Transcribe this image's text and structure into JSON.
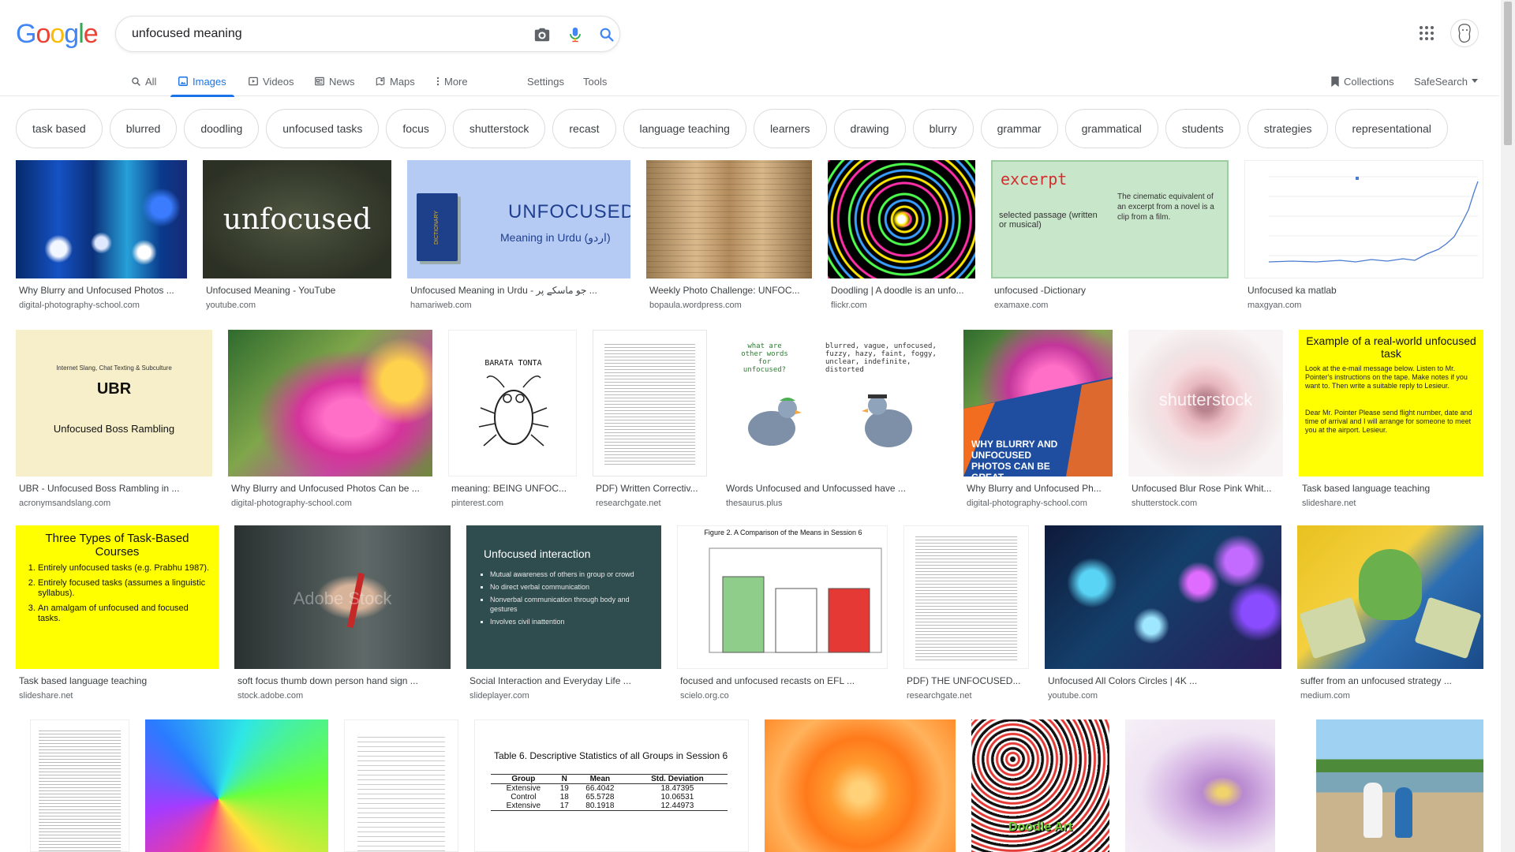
{
  "logo": [
    "G",
    "o",
    "o",
    "g",
    "l",
    "e"
  ],
  "search": {
    "query": "unfocused meaning"
  },
  "nav": {
    "tabs": [
      "All",
      "Images",
      "Videos",
      "News",
      "Maps",
      "More"
    ],
    "settings": "Settings",
    "tools": "Tools",
    "collections": "Collections",
    "safesearch": "SafeSearch"
  },
  "chips": [
    "task based",
    "blurred",
    "doodling",
    "unfocused tasks",
    "focus",
    "shutterstock",
    "recast",
    "language teaching",
    "learners",
    "drawing",
    "blurry",
    "grammar",
    "grammatical",
    "students",
    "strategies",
    "representational"
  ],
  "results": [
    {
      "title": "Why Blurry and Unfocused Photos ...",
      "source": "digital-photography-school.com"
    },
    {
      "title": "Unfocused Meaning - YouTube",
      "source": "youtube.com",
      "text": "unfocused"
    },
    {
      "title": "Unfocused Meaning in Urdu - جو ماسکے پر ...",
      "source": "hamariweb.com",
      "text": "UNFOCUSED",
      "text2": "Meaning in Urdu (اردو)",
      "text3": "DICTIONARY"
    },
    {
      "title": "Weekly Photo Challenge: UNFOC...",
      "source": "bopaula.wordpress.com"
    },
    {
      "title": "Doodling | A doodle is an unfo...",
      "source": "flickr.com"
    },
    {
      "title": "unfocused -Dictionary",
      "source": "examaxe.com",
      "text": "excerpt",
      "text2": "selected passage (written or musical)",
      "text3": "The cinematic equivalent of an excerpt from a novel is a clip from a film."
    },
    {
      "title": "Unfocused ka matlab",
      "source": "maxgyan.com"
    },
    {
      "title": "UBR - Unfocused Boss Rambling in ...",
      "source": "acronymsandslang.com",
      "text": "UBR",
      "text2": "Unfocused Boss Rambling",
      "text3": "Internet Slang, Chat Texting & Subculture"
    },
    {
      "title": "Why Blurry and Unfocused Photos Can be ...",
      "source": "digital-photography-school.com"
    },
    {
      "title": "meaning: BEING UNFOC...",
      "source": "pinterest.com",
      "text": "BARATA TONTA"
    },
    {
      "title": "PDF) Written Correctiv...",
      "source": "researchgate.net"
    },
    {
      "title": "Words Unfocused and Unfocussed have ...",
      "source": "thesaurus.plus",
      "text": "what are other words for unfocused?",
      "text2": "blurred, vague, unfocused, fuzzy, hazy, faint, foggy, unclear, indefinite, distorted"
    },
    {
      "title": "Why Blurry and Unfocused Ph...",
      "source": "digital-photography-school.com",
      "text": "WHY BLURRY AND UNFOCUSED PHOTOS CAN BE GREAT"
    },
    {
      "title": "Unfocused Blur Rose Pink Whit...",
      "source": "shutterstock.com",
      "text": "shutterstock"
    },
    {
      "title": "Task based language teaching",
      "source": "slideshare.net",
      "text": "Example of a real-world unfocused task",
      "text2": "Look at the e-mail message below. Listen to Mr. Pointer's instructions on the tape. Make notes if you want to. Then write a suitable reply to Lesieur.",
      "text3": "Dear Mr. Pointer Please send flight number, date and time of arrival and I will arrange for someone to meet you at the airport. Lesieur."
    },
    {
      "title": "Task based language teaching",
      "source": "slideshare.net",
      "text": "Three Types of Task-Based Courses",
      "items": [
        "Entirely unfocused tasks (e.g. Prabhu 1987).",
        "Entirely focused tasks (assumes a linguistic syllabus).",
        "An amalgam of unfocused and focused tasks."
      ]
    },
    {
      "title": "soft focus thumb down person hand sign ...",
      "source": "stock.adobe.com",
      "text": "Adobe Stock"
    },
    {
      "title": "Social Interaction and Everyday Life ...",
      "source": "slideplayer.com",
      "text": "Unfocused interaction",
      "items": [
        "Mutual awareness of others in group or crowd",
        "No direct verbal communication",
        "Nonverbal communication through body and gestures",
        "Involves civil inattention"
      ]
    },
    {
      "title": "focused and unfocused recasts on EFL ...",
      "source": "scielo.org.co",
      "text": "Figure 2. A Comparison of the Means in Session 6"
    },
    {
      "title": "PDF) THE UNFOCUSED...",
      "source": "researchgate.net"
    },
    {
      "title": "Unfocused All Colors Circles | 4K ...",
      "source": "youtube.com"
    },
    {
      "title": "suffer from an unfocused strategy ...",
      "source": "medium.com"
    },
    {
      "title": "",
      "source": ""
    },
    {
      "title": "",
      "source": ""
    },
    {
      "title": "",
      "source": ""
    },
    {
      "title": "",
      "source": "",
      "text": "Table 6. Descriptive Statistics of all Groups in Session 6",
      "headers": [
        "Group",
        "N",
        "Mean",
        "Std. Deviation"
      ],
      "rows": [
        [
          "Extensive",
          "19",
          "66.4042",
          "18.47395"
        ],
        [
          "Control",
          "18",
          "65.5728",
          "10.06531"
        ],
        [
          "Extensive",
          "17",
          "80.1918",
          "12.44973"
        ]
      ]
    },
    {
      "title": "",
      "source": ""
    },
    {
      "title": "",
      "source": "",
      "text": "Doodle Art"
    },
    {
      "title": "",
      "source": ""
    },
    {
      "title": "",
      "source": ""
    }
  ],
  "colors": {
    "blue": "#1a73e8",
    "google_blue": "#4285f4",
    "google_red": "#ea4335",
    "google_yellow": "#fbbc05",
    "google_green": "#34a853"
  }
}
